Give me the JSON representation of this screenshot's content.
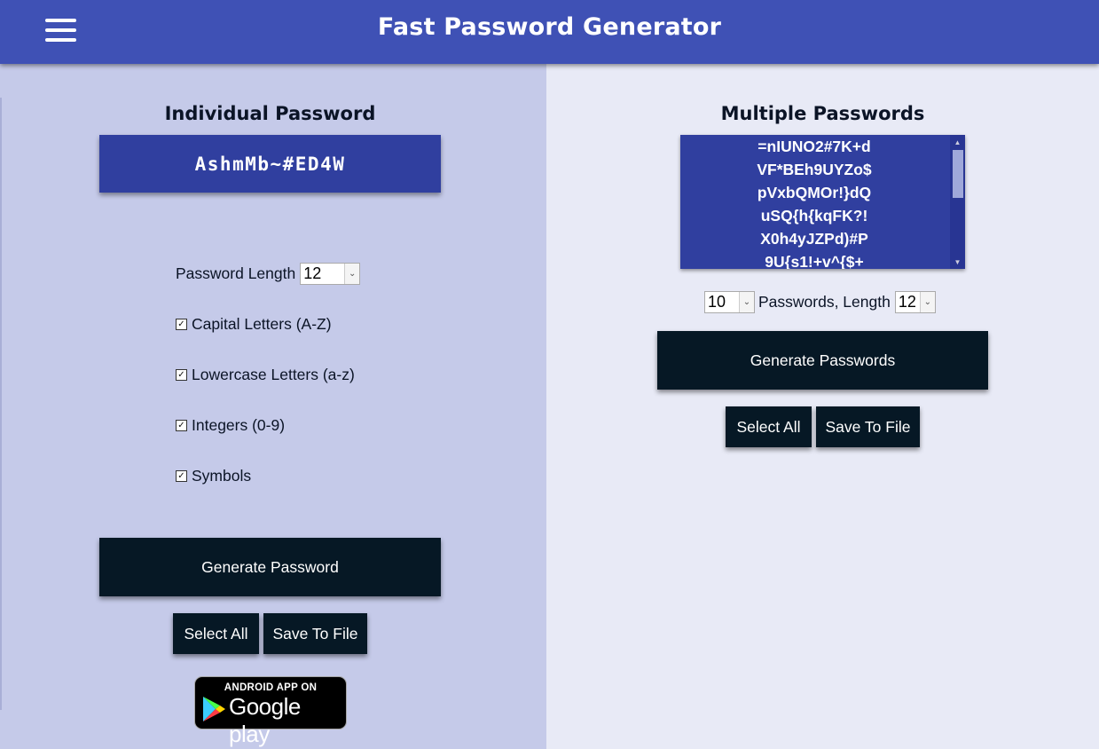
{
  "header": {
    "title": "Fast Password Generator",
    "menu_icon": "hamburger-menu-icon"
  },
  "individual": {
    "title": "Individual Password",
    "password": "AshmMb~#ED4W",
    "length_label": "Password Length",
    "length_value": "12",
    "options": [
      {
        "label": "Capital Letters (A-Z)",
        "checked": true
      },
      {
        "label": "Lowercase Letters (a-z)",
        "checked": true
      },
      {
        "label": "Integers (0-9)",
        "checked": true
      },
      {
        "label": "Symbols",
        "checked": true
      }
    ],
    "generate_label": "Generate Password",
    "select_all_label": "Select All",
    "save_label": "Save To File"
  },
  "badge": {
    "top_text": "ANDROID APP ON",
    "bottom_text": "Google play"
  },
  "multiple": {
    "title": "Multiple Passwords",
    "passwords": [
      "=nIUNO2#7K+d",
      "VF*BEh9UYZo$",
      "pVxbQMOr!}dQ",
      "uSQ{h{kqFK?!",
      "X0h4yJZPd)#P",
      "9U{s1!+v^{$+"
    ],
    "count_value": "10",
    "count_label": "Passwords, Length",
    "length_value": "12",
    "generate_label": "Generate Passwords",
    "select_all_label": "Select All",
    "save_label": "Save To File"
  },
  "colors": {
    "header": "#3f51b5",
    "left_panel": "#c5cae9",
    "right_panel": "#e8eaf6",
    "password_box": "#303f9f",
    "dark_button": "#061825"
  }
}
